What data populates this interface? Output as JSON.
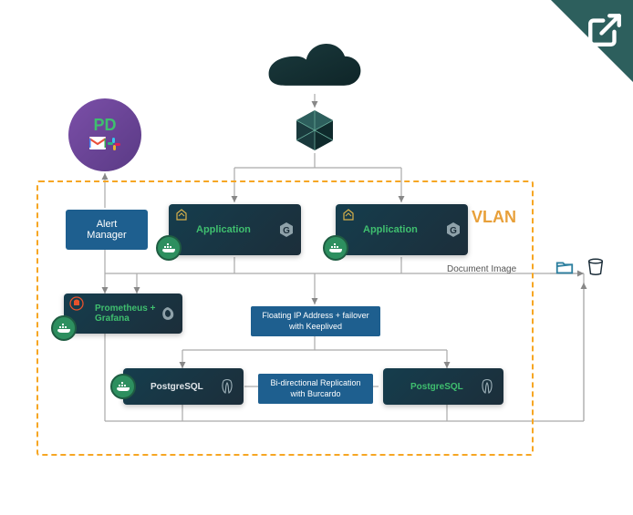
{
  "diagram": {
    "vlan_label": "VLAN",
    "notifications": {
      "pd": "PD"
    },
    "alert_manager": {
      "label": "Alert Manager"
    },
    "nodes": {
      "app1": {
        "label": "Application"
      },
      "app2": {
        "label": "Application"
      },
      "monitoring": {
        "label_line1": "Prometheus +",
        "label_line2": "Grafana"
      },
      "db1": {
        "label": "PostgreSQL"
      },
      "db2": {
        "label": "PostgreSQL"
      }
    },
    "connectors": {
      "floating_ip": {
        "line1": "Floating IP Address + failover",
        "line2": "with Keeplived"
      },
      "replication": {
        "line1": "Bi-directional Replication",
        "line2": "with Burcardo"
      },
      "doc_image": "Document Image"
    }
  }
}
